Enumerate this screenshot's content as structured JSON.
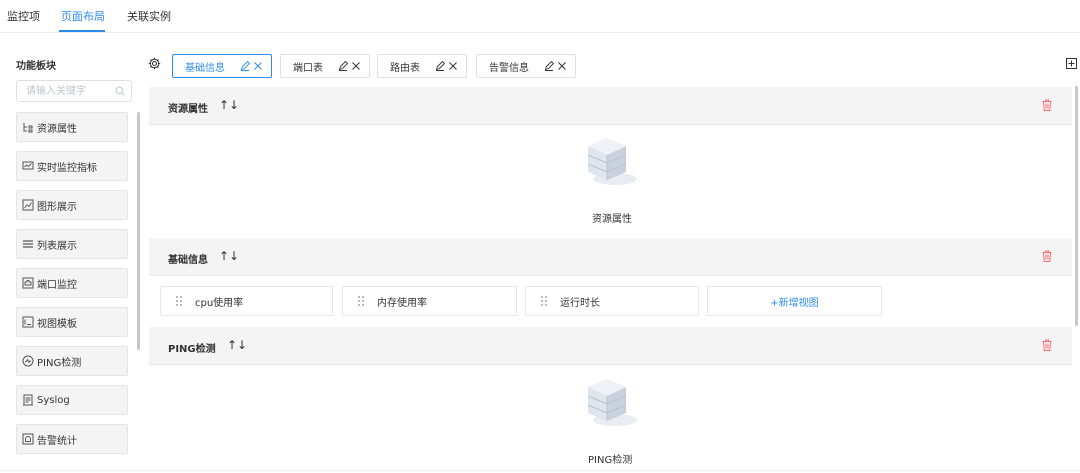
{
  "top_tabs": [
    {
      "label": "监控项",
      "active": false
    },
    {
      "label": "页面布局",
      "active": true
    },
    {
      "label": "关联实例",
      "active": false
    }
  ],
  "left_panel": {
    "title": "功能板块",
    "search_placeholder": "请输入关键字",
    "widgets": [
      {
        "label": "资源属性",
        "icon": "tree-icon"
      },
      {
        "label": "实时监控指标",
        "icon": "monitor-icon"
      },
      {
        "label": "图形展示",
        "icon": "line-chart-icon"
      },
      {
        "label": "列表展示",
        "icon": "list-icon"
      },
      {
        "label": "端口监控",
        "icon": "port-icon"
      },
      {
        "label": "视图模板",
        "icon": "template-icon"
      },
      {
        "label": "PING检测",
        "icon": "ping-icon"
      },
      {
        "label": "Syslog",
        "icon": "syslog-icon"
      },
      {
        "label": "告警统计",
        "icon": "alarm-icon"
      }
    ]
  },
  "toolbar": {
    "tabs": [
      {
        "label": "基础信息",
        "active": true
      },
      {
        "label": "端口表",
        "active": false
      },
      {
        "label": "路由表",
        "active": false
      },
      {
        "label": "告警信息",
        "active": false
      }
    ]
  },
  "sections": [
    {
      "title": "资源属性",
      "arrows": "↑↓",
      "caption": "资源属性"
    },
    {
      "title": "基础信息",
      "arrows": "↑↓"
    },
    {
      "title": "PING检测",
      "arrows": "↑↓",
      "caption": "PING检测"
    }
  ],
  "cards": {
    "items": [
      "cpu使用率",
      "内存使用率",
      "运行时长"
    ],
    "add_label": "+新增视图"
  },
  "colors": {
    "accent": "#2d8cf0",
    "danger": "#f56c6c",
    "panel_bg": "#f4f4f5"
  }
}
